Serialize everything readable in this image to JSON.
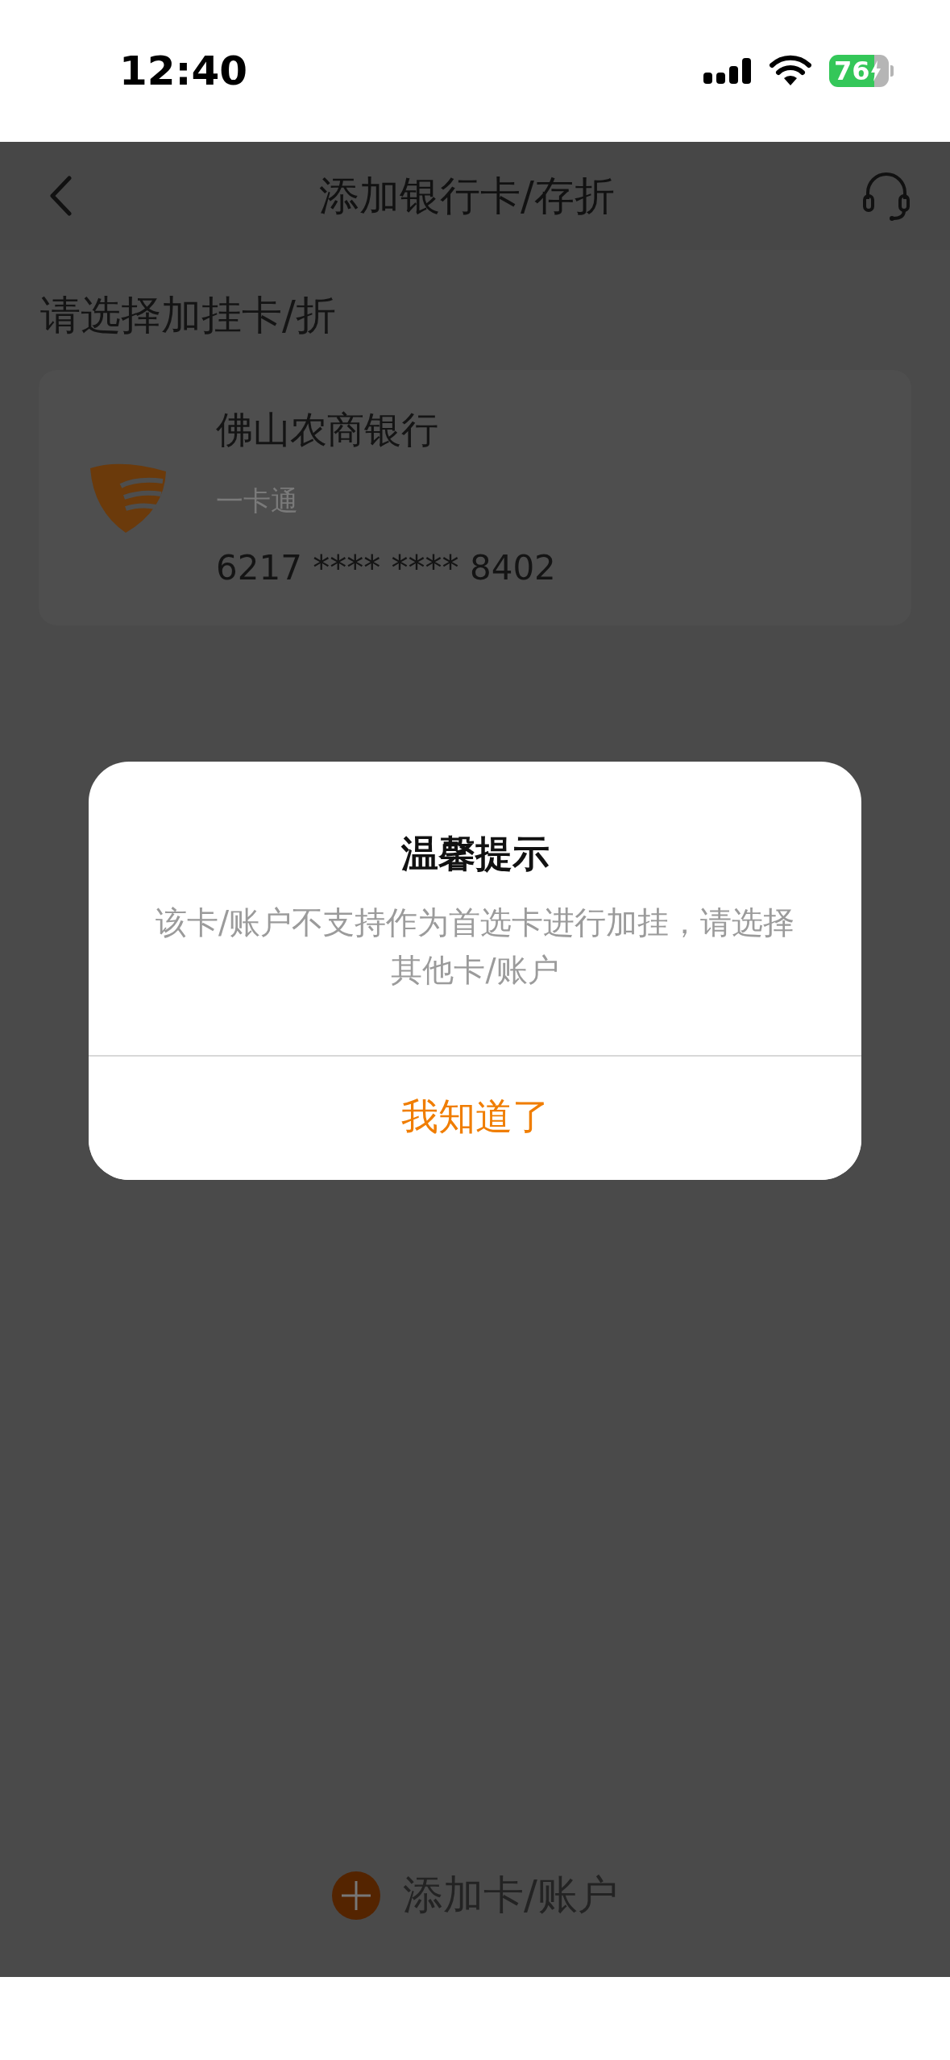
{
  "status_bar": {
    "time": "12:40",
    "battery": "76",
    "charging": true
  },
  "header": {
    "title": "添加银行卡/存折"
  },
  "section_title": "请选择加挂卡/折",
  "cards": [
    {
      "bank": "佛山农商银行",
      "type": "一卡通",
      "number": "6217 **** **** 8402"
    }
  ],
  "dialog": {
    "title": "温馨提示",
    "message": "该卡/账户不支持作为首选卡进行加挂，请选择其他卡/账户",
    "button": "我知道了"
  },
  "footer": {
    "add_label": "添加卡/账户"
  }
}
